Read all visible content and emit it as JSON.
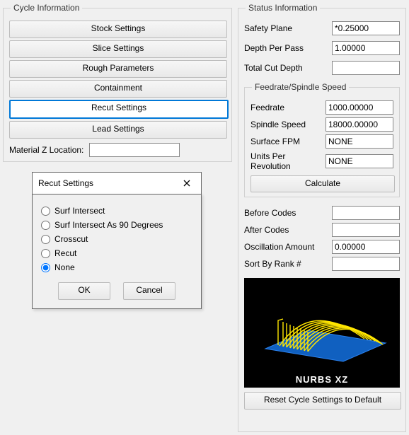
{
  "cycle": {
    "legend": "Cycle Information",
    "buttons": {
      "stock": "Stock Settings",
      "slice": "Slice Settings",
      "rough": "Rough Parameters",
      "containment": "Containment",
      "recut": "Recut Settings",
      "lead": "Lead Settings"
    },
    "material_z": {
      "label": "Material Z Location:",
      "value": ""
    }
  },
  "modal": {
    "title": "Recut Settings",
    "options": {
      "surf_intersect": "Surf Intersect",
      "surf_intersect_90": "Surf Intersect As 90 Degrees",
      "crosscut": "Crosscut",
      "recut": "Recut",
      "none": "None"
    },
    "selected": "none",
    "ok": "OK",
    "cancel": "Cancel"
  },
  "status": {
    "legend": "Status Information",
    "safety_plane": {
      "label": "Safety Plane",
      "value": "*0.25000"
    },
    "depth_per_pass": {
      "label": "Depth Per Pass",
      "value": "1.00000"
    },
    "total_cut_depth": {
      "label": "Total Cut Depth",
      "value": ""
    },
    "feedrate_group": {
      "legend": "Feedrate/Spindle Speed",
      "feedrate": {
        "label": "Feedrate",
        "value": "1000.00000"
      },
      "spindle_speed": {
        "label": "Spindle Speed",
        "value": "18000.00000"
      },
      "surface_fpm": {
        "label": "Surface FPM",
        "value": "NONE"
      },
      "units_per_rev": {
        "label": "Units Per Revolution",
        "value": "NONE"
      },
      "calculate": "Calculate"
    },
    "before_codes": {
      "label": "Before Codes",
      "value": ""
    },
    "after_codes": {
      "label": "After Codes",
      "value": ""
    },
    "oscillation": {
      "label": "Oscillation Amount",
      "value": "0.00000"
    },
    "sort_rank": {
      "label": "Sort By Rank #",
      "value": ""
    },
    "thumb_caption": "NURBS XZ",
    "reset": "Reset Cycle Settings to Default"
  }
}
